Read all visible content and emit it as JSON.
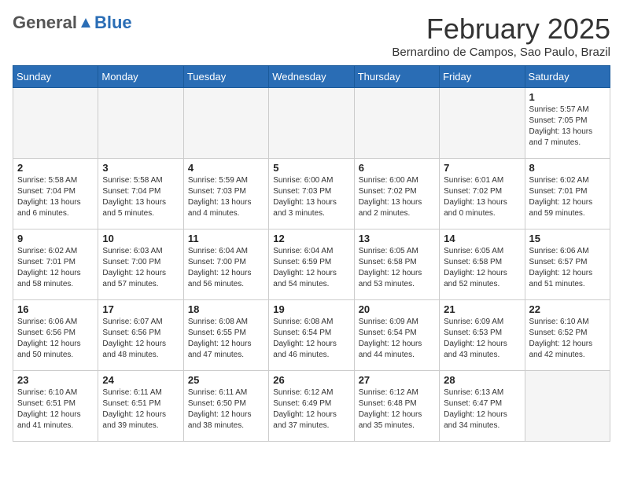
{
  "logo": {
    "general": "General",
    "blue": "Blue"
  },
  "header": {
    "month": "February 2025",
    "location": "Bernardino de Campos, Sao Paulo, Brazil"
  },
  "days_of_week": [
    "Sunday",
    "Monday",
    "Tuesday",
    "Wednesday",
    "Thursday",
    "Friday",
    "Saturday"
  ],
  "weeks": [
    [
      {
        "day": "",
        "info": ""
      },
      {
        "day": "",
        "info": ""
      },
      {
        "day": "",
        "info": ""
      },
      {
        "day": "",
        "info": ""
      },
      {
        "day": "",
        "info": ""
      },
      {
        "day": "",
        "info": ""
      },
      {
        "day": "1",
        "info": "Sunrise: 5:57 AM\nSunset: 7:05 PM\nDaylight: 13 hours\nand 7 minutes."
      }
    ],
    [
      {
        "day": "2",
        "info": "Sunrise: 5:58 AM\nSunset: 7:04 PM\nDaylight: 13 hours\nand 6 minutes."
      },
      {
        "day": "3",
        "info": "Sunrise: 5:58 AM\nSunset: 7:04 PM\nDaylight: 13 hours\nand 5 minutes."
      },
      {
        "day": "4",
        "info": "Sunrise: 5:59 AM\nSunset: 7:03 PM\nDaylight: 13 hours\nand 4 minutes."
      },
      {
        "day": "5",
        "info": "Sunrise: 6:00 AM\nSunset: 7:03 PM\nDaylight: 13 hours\nand 3 minutes."
      },
      {
        "day": "6",
        "info": "Sunrise: 6:00 AM\nSunset: 7:02 PM\nDaylight: 13 hours\nand 2 minutes."
      },
      {
        "day": "7",
        "info": "Sunrise: 6:01 AM\nSunset: 7:02 PM\nDaylight: 13 hours\nand 0 minutes."
      },
      {
        "day": "8",
        "info": "Sunrise: 6:02 AM\nSunset: 7:01 PM\nDaylight: 12 hours\nand 59 minutes."
      }
    ],
    [
      {
        "day": "9",
        "info": "Sunrise: 6:02 AM\nSunset: 7:01 PM\nDaylight: 12 hours\nand 58 minutes."
      },
      {
        "day": "10",
        "info": "Sunrise: 6:03 AM\nSunset: 7:00 PM\nDaylight: 12 hours\nand 57 minutes."
      },
      {
        "day": "11",
        "info": "Sunrise: 6:04 AM\nSunset: 7:00 PM\nDaylight: 12 hours\nand 56 minutes."
      },
      {
        "day": "12",
        "info": "Sunrise: 6:04 AM\nSunset: 6:59 PM\nDaylight: 12 hours\nand 54 minutes."
      },
      {
        "day": "13",
        "info": "Sunrise: 6:05 AM\nSunset: 6:58 PM\nDaylight: 12 hours\nand 53 minutes."
      },
      {
        "day": "14",
        "info": "Sunrise: 6:05 AM\nSunset: 6:58 PM\nDaylight: 12 hours\nand 52 minutes."
      },
      {
        "day": "15",
        "info": "Sunrise: 6:06 AM\nSunset: 6:57 PM\nDaylight: 12 hours\nand 51 minutes."
      }
    ],
    [
      {
        "day": "16",
        "info": "Sunrise: 6:06 AM\nSunset: 6:56 PM\nDaylight: 12 hours\nand 50 minutes."
      },
      {
        "day": "17",
        "info": "Sunrise: 6:07 AM\nSunset: 6:56 PM\nDaylight: 12 hours\nand 48 minutes."
      },
      {
        "day": "18",
        "info": "Sunrise: 6:08 AM\nSunset: 6:55 PM\nDaylight: 12 hours\nand 47 minutes."
      },
      {
        "day": "19",
        "info": "Sunrise: 6:08 AM\nSunset: 6:54 PM\nDaylight: 12 hours\nand 46 minutes."
      },
      {
        "day": "20",
        "info": "Sunrise: 6:09 AM\nSunset: 6:54 PM\nDaylight: 12 hours\nand 44 minutes."
      },
      {
        "day": "21",
        "info": "Sunrise: 6:09 AM\nSunset: 6:53 PM\nDaylight: 12 hours\nand 43 minutes."
      },
      {
        "day": "22",
        "info": "Sunrise: 6:10 AM\nSunset: 6:52 PM\nDaylight: 12 hours\nand 42 minutes."
      }
    ],
    [
      {
        "day": "23",
        "info": "Sunrise: 6:10 AM\nSunset: 6:51 PM\nDaylight: 12 hours\nand 41 minutes."
      },
      {
        "day": "24",
        "info": "Sunrise: 6:11 AM\nSunset: 6:51 PM\nDaylight: 12 hours\nand 39 minutes."
      },
      {
        "day": "25",
        "info": "Sunrise: 6:11 AM\nSunset: 6:50 PM\nDaylight: 12 hours\nand 38 minutes."
      },
      {
        "day": "26",
        "info": "Sunrise: 6:12 AM\nSunset: 6:49 PM\nDaylight: 12 hours\nand 37 minutes."
      },
      {
        "day": "27",
        "info": "Sunrise: 6:12 AM\nSunset: 6:48 PM\nDaylight: 12 hours\nand 35 minutes."
      },
      {
        "day": "28",
        "info": "Sunrise: 6:13 AM\nSunset: 6:47 PM\nDaylight: 12 hours\nand 34 minutes."
      },
      {
        "day": "",
        "info": ""
      }
    ]
  ]
}
